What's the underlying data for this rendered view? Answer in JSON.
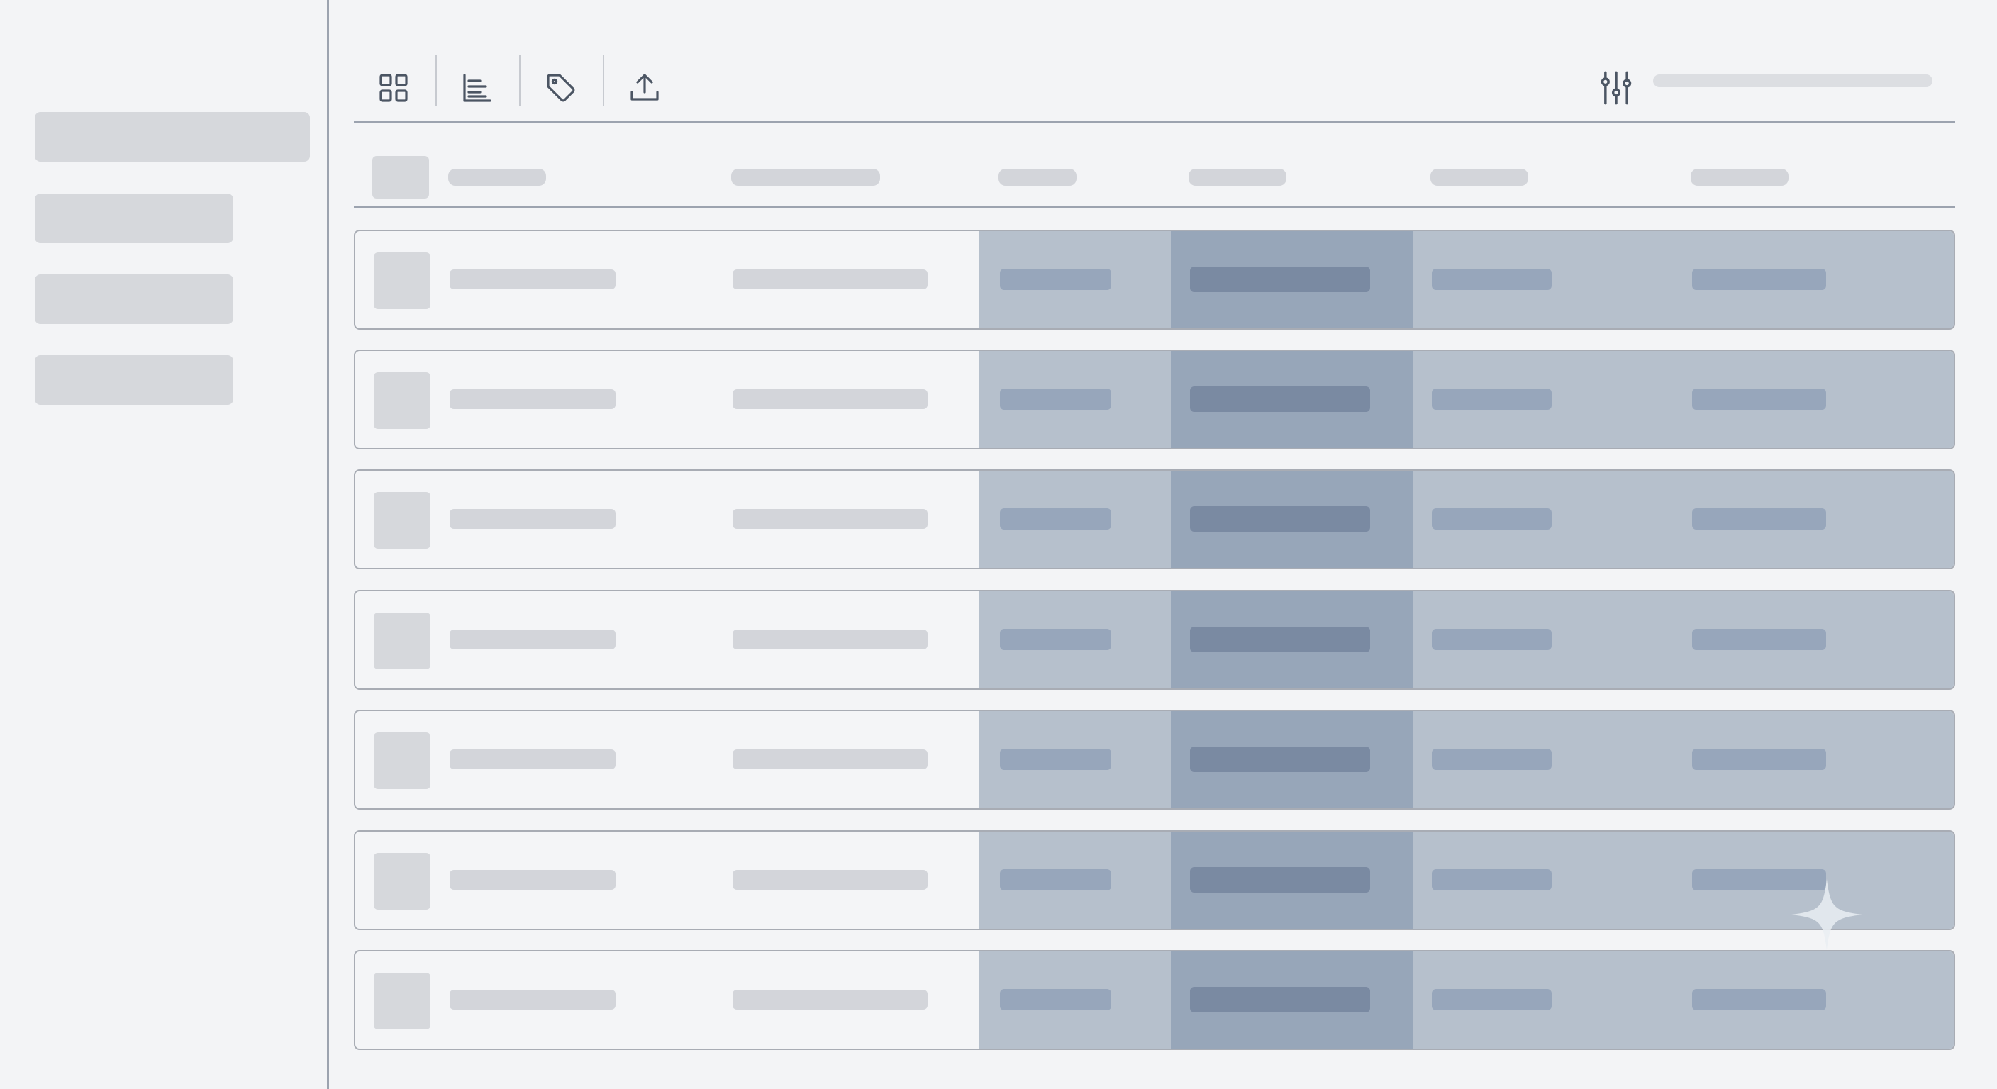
{
  "colors": {
    "background": "#f3f4f6",
    "placeholder_light": "#d3d5da",
    "col_band_a": "#b6c0cc",
    "col_band_b": "#97a6b9",
    "bar_light": "#97a6bb",
    "bar_dark": "#7a8aa2",
    "icon_stroke": "#4b5563"
  },
  "sidebar": {
    "items": [
      {
        "name": "sidebar-item-1"
      },
      {
        "name": "sidebar-item-2"
      },
      {
        "name": "sidebar-item-3"
      },
      {
        "name": "sidebar-item-4"
      }
    ]
  },
  "toolbar": {
    "icons": [
      "grid-view-icon",
      "align-left-icon",
      "tag-icon",
      "upload-icon"
    ],
    "filter_icon": "sliders-icon"
  },
  "table": {
    "row_count": 7
  }
}
